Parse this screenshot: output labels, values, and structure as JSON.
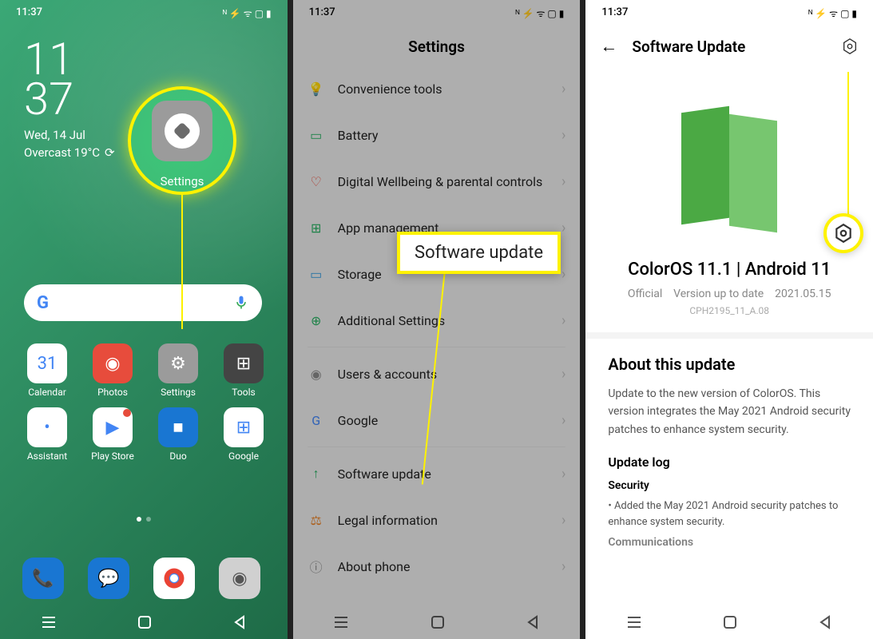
{
  "status_time": "11:37",
  "phone1": {
    "clock_line1": "11",
    "clock_line2": "37",
    "date": "Wed, 14 Jul",
    "weather": "Overcast 19°C",
    "settings_label": "Settings",
    "apps": [
      {
        "label": "Calendar",
        "bg": "#fff",
        "glyph": "31"
      },
      {
        "label": "Photos",
        "bg": "#e74c3c",
        "glyph": "◉"
      },
      {
        "label": "Settings",
        "bg": "#9b9b9b",
        "glyph": "⚙"
      },
      {
        "label": "Tools",
        "bg": "#444",
        "glyph": "⊞"
      },
      {
        "label": "Assistant",
        "bg": "#fff",
        "glyph": "•"
      },
      {
        "label": "Play Store",
        "bg": "#fff",
        "glyph": "▶"
      },
      {
        "label": "Duo",
        "bg": "#1976d2",
        "glyph": "■"
      },
      {
        "label": "Google",
        "bg": "#fff",
        "glyph": "⊞"
      }
    ]
  },
  "phone2": {
    "title": "Settings",
    "items": [
      {
        "label": "Convenience tools",
        "icon": "💡",
        "color": "#f39c12"
      },
      {
        "label": "Battery",
        "icon": "▭",
        "color": "#27ae60"
      },
      {
        "label": "Digital Wellbeing & parental controls",
        "icon": "♡",
        "color": "#e74c3c"
      },
      {
        "label": "App management",
        "icon": "⊞",
        "color": "#27ae60"
      },
      {
        "label": "Storage",
        "icon": "▭",
        "color": "#3498db"
      },
      {
        "label": "Additional Settings",
        "icon": "⊕",
        "color": "#27ae60",
        "divider": true
      },
      {
        "label": "Users & accounts",
        "icon": "◉",
        "color": "#888"
      },
      {
        "label": "Google",
        "icon": "G",
        "color": "#4285f4",
        "divider": true
      },
      {
        "label": "Software update",
        "icon": "↑",
        "color": "#27ae60"
      },
      {
        "label": "Legal information",
        "icon": "⚖",
        "color": "#e67e22"
      },
      {
        "label": "About phone",
        "icon": "ⓘ",
        "color": "#888"
      }
    ],
    "callout": "Software update"
  },
  "phone3": {
    "title": "Software Update",
    "os_version": "ColorOS 11.1 | Android 11",
    "meta_official": "Official",
    "meta_status": "Version up to date",
    "meta_date": "2021.05.15",
    "build": "CPH2195_11_A.08",
    "about_title": "About this update",
    "about_text": "Update to the new version of ColorOS. This version integrates the May 2021 Android security patches to enhance system security.",
    "log_title": "Update log",
    "log_security_title": "Security",
    "log_security_item": "• Added the May 2021 Android security patches to enhance system security.",
    "log_comm_title": "Communications"
  }
}
